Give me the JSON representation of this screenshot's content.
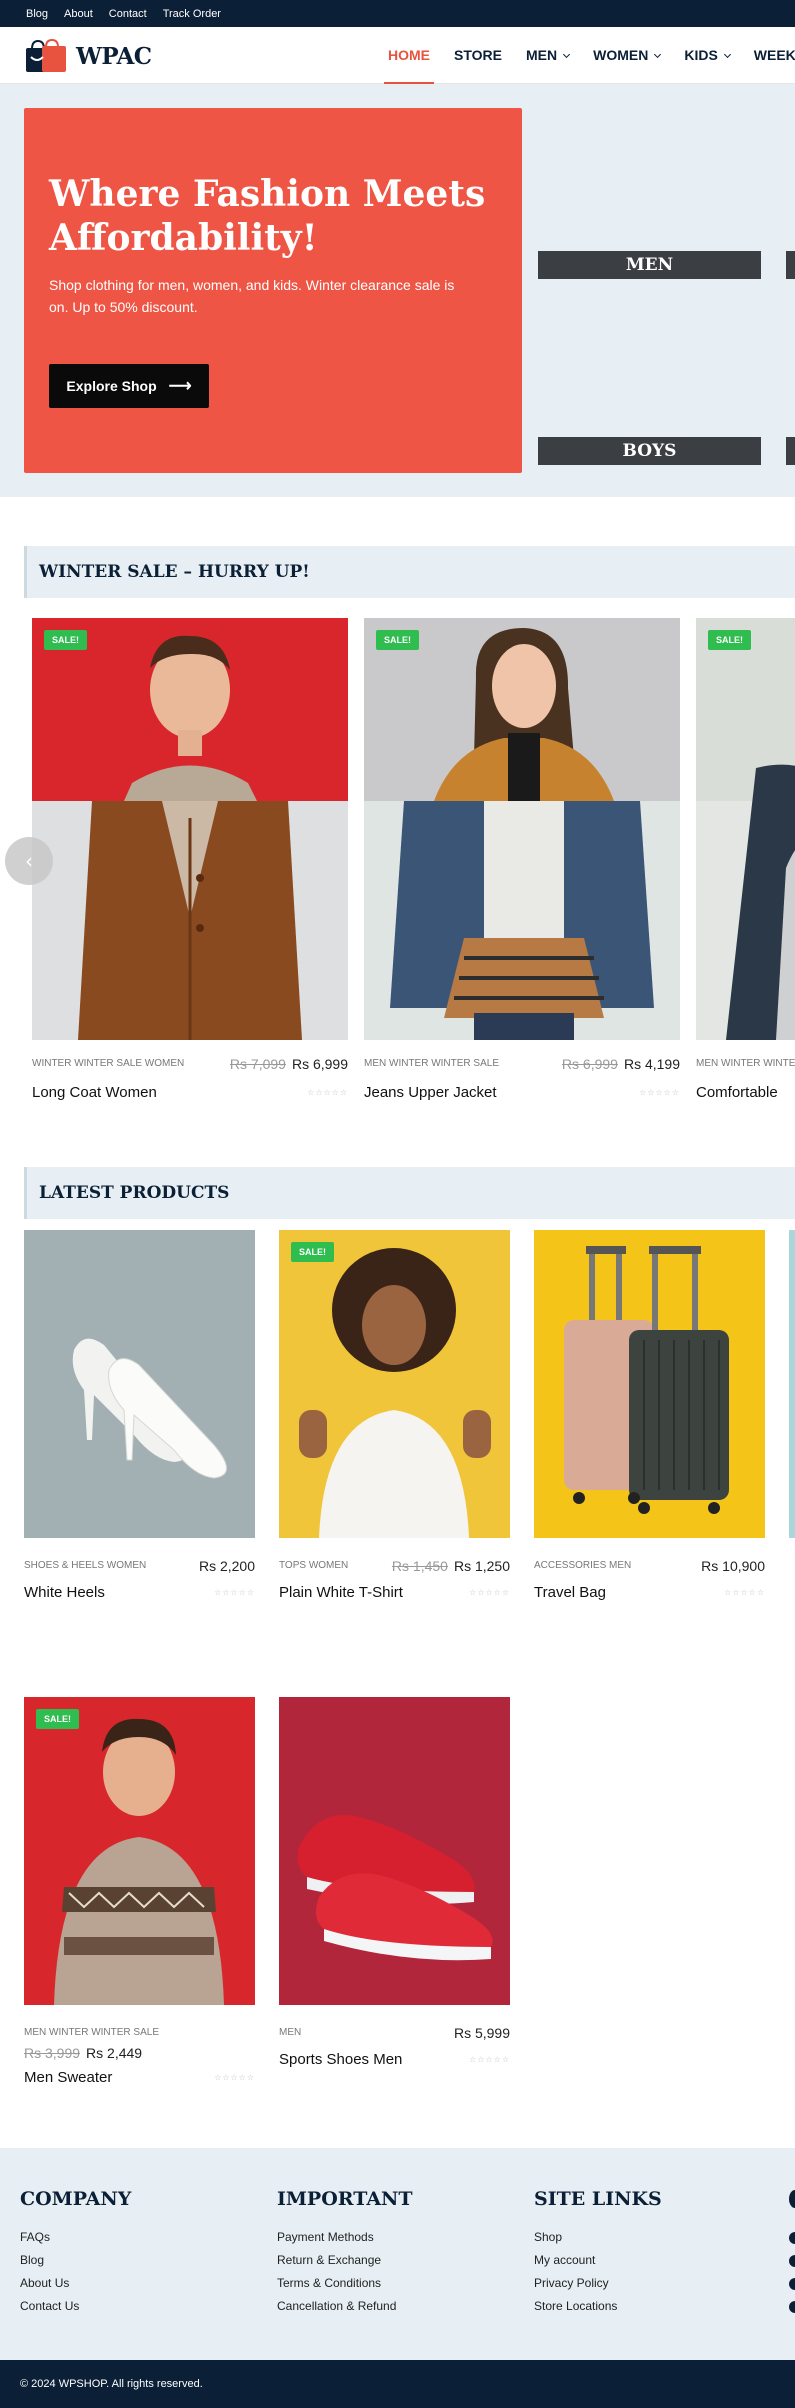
{
  "topbar": {
    "links": [
      "Blog",
      "About",
      "Contact",
      "Track Order"
    ]
  },
  "header": {
    "logo_text": "WPAC",
    "nav": [
      {
        "label": "HOME",
        "active": true,
        "dropdown": false
      },
      {
        "label": "STORE",
        "active": false,
        "dropdown": false
      },
      {
        "label": "MEN",
        "active": false,
        "dropdown": true
      },
      {
        "label": "WOMEN",
        "active": false,
        "dropdown": true
      },
      {
        "label": "KIDS",
        "active": false,
        "dropdown": true
      },
      {
        "label": "WEEKLY S",
        "active": false,
        "dropdown": false
      }
    ]
  },
  "hero": {
    "title": "Where Fashion Meets Affordability!",
    "subtitle": "Shop clothing for men, women, and kids. Winter clearance sale is on. Up to 50% discount.",
    "cta": "Explore Shop",
    "categories": [
      "MEN",
      "BOYS"
    ]
  },
  "winter_sale": {
    "title": "WINTER SALE – HURRY UP!",
    "products": [
      {
        "name": "Long Coat Women",
        "cats": "WINTER  WINTER SALE  WOMEN",
        "old_price": "Rs 7,099",
        "price": "Rs 6,999",
        "sale": "SALE!"
      },
      {
        "name": "Jeans Upper Jacket",
        "cats": "MEN  WINTER  WINTER SALE",
        "old_price": "Rs 6,999",
        "price": "Rs 4,199",
        "sale": "SALE!"
      },
      {
        "name": "Comfortable",
        "cats": "MEN  WINTER  WINTER",
        "old_price": "",
        "price": "",
        "sale": "SALE!"
      }
    ]
  },
  "latest": {
    "title": "LATEST PRODUCTS",
    "products": [
      {
        "name": "White Heels",
        "cats": "SHOES & HEELS  WOMEN",
        "old_price": "",
        "price": "Rs 2,200",
        "sale": ""
      },
      {
        "name": "Plain White T-Shirt",
        "cats": "TOPS  WOMEN",
        "old_price": "Rs 1,450",
        "price": "Rs 1,250",
        "sale": "SALE!"
      },
      {
        "name": "Travel Bag",
        "cats": "ACCESSORIES  MEN",
        "old_price": "",
        "price": "Rs 10,900",
        "sale": ""
      },
      {
        "name": "Men Sweater",
        "cats": "MEN  WINTER  WINTER SALE",
        "old_price": "Rs 3,999",
        "price": "Rs 2,449",
        "sale": "SALE!"
      },
      {
        "name": "Sports Shoes Men",
        "cats": "MEN",
        "old_price": "",
        "price": "Rs 5,999",
        "sale": ""
      }
    ]
  },
  "footer": {
    "columns": [
      {
        "title": "COMPANY",
        "links": [
          "FAQs",
          "Blog",
          "About Us",
          "Contact Us"
        ]
      },
      {
        "title": "IMPORTANT",
        "links": [
          "Payment Methods",
          "Return & Exchange",
          "Terms & Conditions",
          "Cancellation & Refund"
        ]
      },
      {
        "title": "SITE LINKS",
        "links": [
          "Shop",
          "My account",
          "Privacy Policy",
          "Store Locations"
        ]
      }
    ],
    "copyright": "© 2024 WPSHOP. All rights reserved."
  },
  "colors": {
    "accent": "#ef5545",
    "navy": "#0b1f36",
    "sale": "#2ebd4e",
    "light": "#e7eff4"
  },
  "stars": "☆☆☆☆☆"
}
